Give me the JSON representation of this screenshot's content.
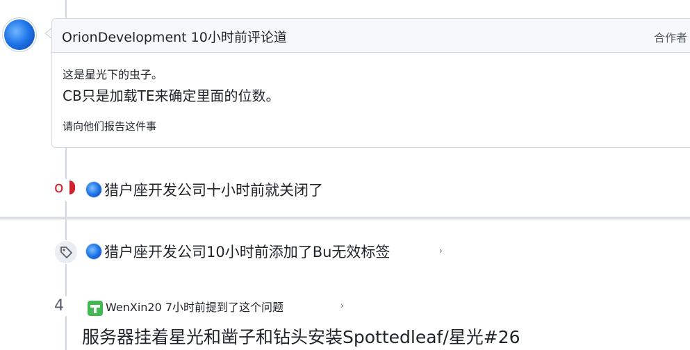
{
  "comment": {
    "author_header": "OrionDevelopment 10小时前评论道",
    "role": "合作者",
    "body_line1": "这是星光下的虫子。",
    "body_line2": "CB只是加载TE来确定里面的位数。",
    "body_line3": "请向他们报告这件事"
  },
  "events": {
    "closed_text": "猎户座开发公司十小时前就关闭了",
    "labeled_text": "猎户座开发公司10小时前添加了Bu无效标签",
    "closed_icon_glyph": "o",
    "referenced": {
      "number": "4",
      "meta": "WenXin20 7小时前提到了这个问题",
      "title": "服务器挂着星光和凿子和钻头安装Spottedleaf/星光#26"
    }
  },
  "colors": {
    "closed": "#cf222e",
    "border": "#d0d7de",
    "header_bg": "#f6f8fa",
    "muted": "#57606a"
  }
}
